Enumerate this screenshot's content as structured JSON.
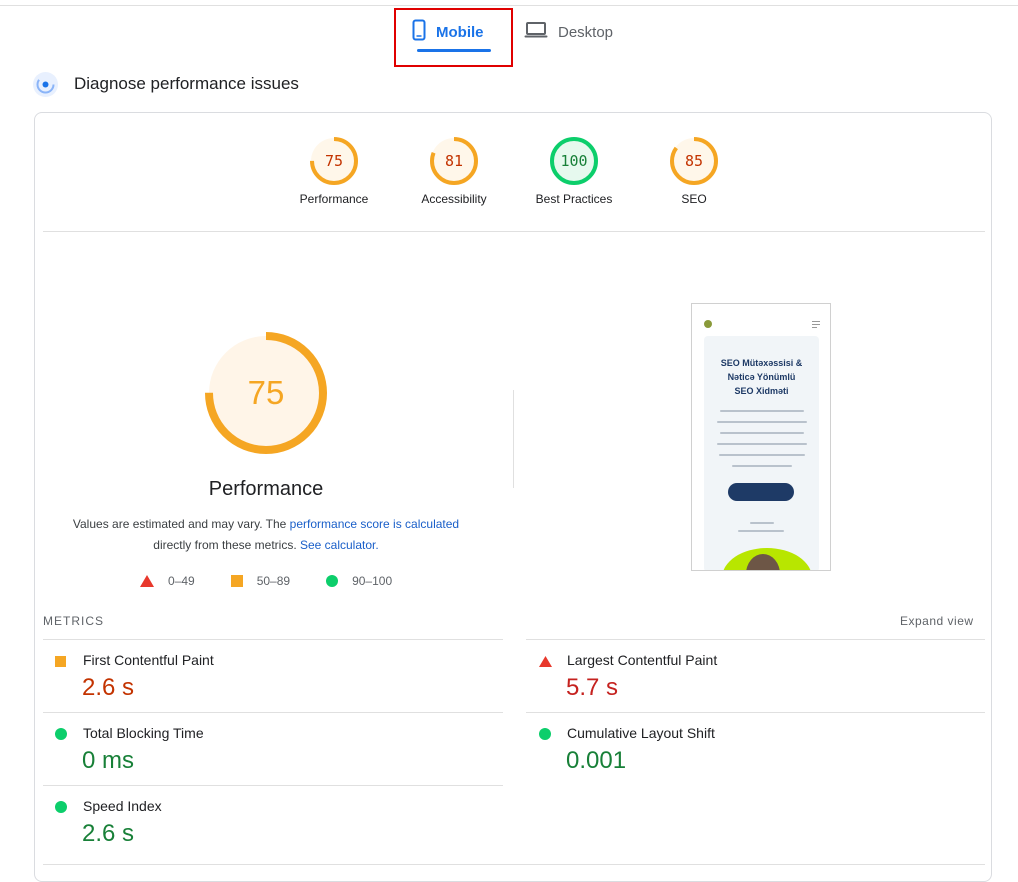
{
  "tabs": [
    {
      "label": "Mobile",
      "active": true,
      "icon": "smartphone-icon"
    },
    {
      "label": "Desktop",
      "active": false,
      "icon": "laptop-icon"
    }
  ],
  "section": {
    "title": "Diagnose performance issues",
    "icon": "diagnose-icon"
  },
  "categories": [
    {
      "label": "Performance",
      "score": "75",
      "value": 75
    },
    {
      "label": "Accessibility",
      "score": "81",
      "value": 81
    },
    {
      "label": "Best Practices",
      "score": "100",
      "value": 100
    },
    {
      "label": "SEO",
      "score": "85",
      "value": 85
    }
  ],
  "performance": {
    "score": "75",
    "value": 75,
    "title": "Performance",
    "desc_prefix": "Values are estimated and may vary. The ",
    "desc_link1": "performance score is calculated",
    "desc_middle": " directly from these metrics. ",
    "desc_link2": "See calculator."
  },
  "legend": [
    {
      "range": "0–49",
      "shape": "triangle",
      "color": "#e8382c"
    },
    {
      "range": "50–89",
      "shape": "square",
      "color": "#f5a623"
    },
    {
      "range": "90–100",
      "shape": "circle",
      "color": "#0cce6b"
    }
  ],
  "screenshot": {
    "title_lines": [
      "SEO Mütəxəssisi &",
      "Nəticə Yönümlü",
      "SEO Xidməti"
    ]
  },
  "metrics": {
    "title": "METRICS",
    "expand_label": "Expand view",
    "items": [
      {
        "name": "First Contentful Paint",
        "value": "2.6 s",
        "status": "average"
      },
      {
        "name": "Largest Contentful Paint",
        "value": "5.7 s",
        "status": "fail"
      },
      {
        "name": "Total Blocking Time",
        "value": "0 ms",
        "status": "pass"
      },
      {
        "name": "Cumulative Layout Shift",
        "value": "0.001",
        "status": "pass"
      },
      {
        "name": "Speed Index",
        "value": "2.6 s",
        "status": "pass"
      }
    ]
  },
  "colors": {
    "accent": "#1a73e8",
    "fail": "#e8382c",
    "fail_text": "#c5221f",
    "average": "#f5a623",
    "average_text": "#c33300",
    "pass": "#0cce6b",
    "pass_text": "#188038",
    "highlight": "#e00000"
  }
}
